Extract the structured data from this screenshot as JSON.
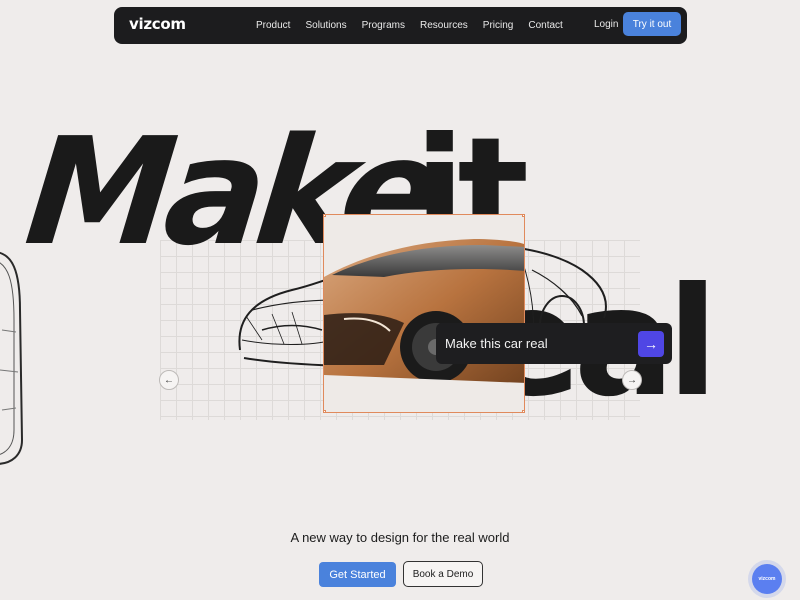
{
  "nav": {
    "logo": "vizcom",
    "links": [
      "Product",
      "Solutions",
      "Programs",
      "Resources",
      "Pricing",
      "Contact"
    ],
    "login": "Login",
    "cta": "Try it out"
  },
  "hero": {
    "headline_part1": "Make",
    "headline_part2": "it real",
    "prompt_text": "Make this car real",
    "prompt_icon": "arrow-right-icon",
    "prev_icon": "arrow-left-icon",
    "next_icon": "arrow-right-icon"
  },
  "footer": {
    "tagline": "A new way to design for the real world",
    "get_started": "Get Started",
    "book_demo": "Book a Demo",
    "chat_label": "vizcom"
  },
  "colors": {
    "background": "#efeceb",
    "nav": "#1c1c1e",
    "accent_blue": "#4a82dc",
    "prompt_button": "#4f46e5",
    "frame_border": "#e08a5c",
    "car_copper": "#b8733f"
  }
}
